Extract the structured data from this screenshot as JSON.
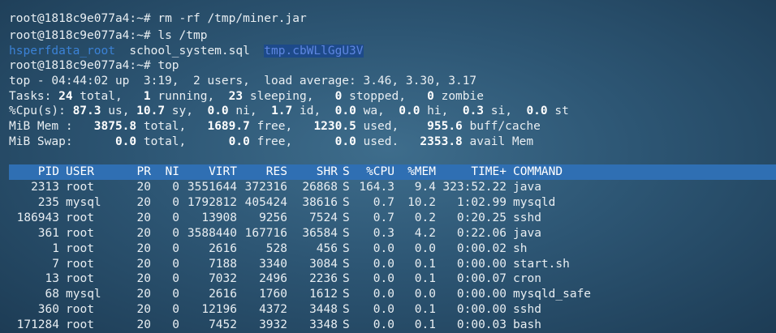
{
  "shell": {
    "prompt": "root@1818c9e077a4:~#",
    "cmd1": "rm -rf /tmp/miner.jar",
    "cmd2": "ls /tmp",
    "cmd3": "top"
  },
  "ls_output": {
    "dir": "hsperfdata_root",
    "file1": "school_system.sql",
    "file2": "tmp.cbWLlGgU3V"
  },
  "top_summary": {
    "line1": "top - 04:44:02 up  3:19,  2 users,  load average: 3.46, 3.30, 3.17",
    "tasks_label": "Tasks: ",
    "tasks_total": "24",
    "tasks_total_lbl": " total,   ",
    "tasks_running": "1",
    "tasks_running_lbl": " running,  ",
    "tasks_sleeping": "23",
    "tasks_sleeping_lbl": " sleeping,   ",
    "tasks_stopped": "0",
    "tasks_stopped_lbl": " stopped,   ",
    "tasks_zombie": "0",
    "tasks_zombie_lbl": " zombie",
    "cpu_label": "%Cpu(s): ",
    "cpu_us": "87.3",
    "cpu_us_lbl": " us, ",
    "cpu_sy": "10.7",
    "cpu_sy_lbl": " sy,  ",
    "cpu_ni": "0.0",
    "cpu_ni_lbl": " ni,  ",
    "cpu_id": "1.7",
    "cpu_id_lbl": " id,  ",
    "cpu_wa": "0.0",
    "cpu_wa_lbl": " wa,  ",
    "cpu_hi": "0.0",
    "cpu_hi_lbl": " hi,  ",
    "cpu_si": "0.3",
    "cpu_si_lbl": " si,  ",
    "cpu_st": "0.0",
    "cpu_st_lbl": " st",
    "mem_label": "MiB Mem :   ",
    "mem_total": "3875.8",
    "mem_total_lbl": " total,   ",
    "mem_free": "1689.7",
    "mem_free_lbl": " free,   ",
    "mem_used": "1230.5",
    "mem_used_lbl": " used,    ",
    "mem_buff": "955.6",
    "mem_buff_lbl": " buff/cache",
    "swap_label": "MiB Swap:      ",
    "swap_total": "0.0",
    "swap_total_lbl": " total,      ",
    "swap_free": "0.0",
    "swap_free_lbl": " free,      ",
    "swap_used": "0.0",
    "swap_used_lbl": " used.   ",
    "swap_avail": "2353.8",
    "swap_avail_lbl": " avail Mem"
  },
  "columns": [
    "PID",
    "USER",
    "PR",
    "NI",
    "VIRT",
    "RES",
    "SHR",
    "S",
    "%CPU",
    "%MEM",
    "TIME+",
    "COMMAND"
  ],
  "processes": [
    [
      "2313",
      "root",
      "20",
      "0",
      "3551644",
      "372316",
      "26868",
      "S",
      "164.3",
      "9.4",
      "323:52.22",
      "java"
    ],
    [
      "235",
      "mysql",
      "20",
      "0",
      "1792812",
      "405424",
      "38616",
      "S",
      "0.7",
      "10.2",
      "1:02.99",
      "mysqld"
    ],
    [
      "186943",
      "root",
      "20",
      "0",
      "13908",
      "9256",
      "7524",
      "S",
      "0.7",
      "0.2",
      "0:20.25",
      "sshd"
    ],
    [
      "361",
      "root",
      "20",
      "0",
      "3588440",
      "167716",
      "36584",
      "S",
      "0.3",
      "4.2",
      "0:22.06",
      "java"
    ],
    [
      "1",
      "root",
      "20",
      "0",
      "2616",
      "528",
      "456",
      "S",
      "0.0",
      "0.0",
      "0:00.02",
      "sh"
    ],
    [
      "7",
      "root",
      "20",
      "0",
      "7188",
      "3340",
      "3084",
      "S",
      "0.0",
      "0.1",
      "0:00.00",
      "start.sh"
    ],
    [
      "13",
      "root",
      "20",
      "0",
      "7032",
      "2496",
      "2236",
      "S",
      "0.0",
      "0.1",
      "0:00.07",
      "cron"
    ],
    [
      "68",
      "mysql",
      "20",
      "0",
      "2616",
      "1760",
      "1612",
      "S",
      "0.0",
      "0.0",
      "0:00.00",
      "mysqld_safe"
    ],
    [
      "360",
      "root",
      "20",
      "0",
      "12196",
      "4372",
      "3448",
      "S",
      "0.0",
      "0.1",
      "0:00.00",
      "sshd"
    ],
    [
      "171284",
      "root",
      "20",
      "0",
      "7452",
      "3932",
      "3348",
      "S",
      "0.0",
      "0.1",
      "0:00.03",
      "bash"
    ]
  ]
}
